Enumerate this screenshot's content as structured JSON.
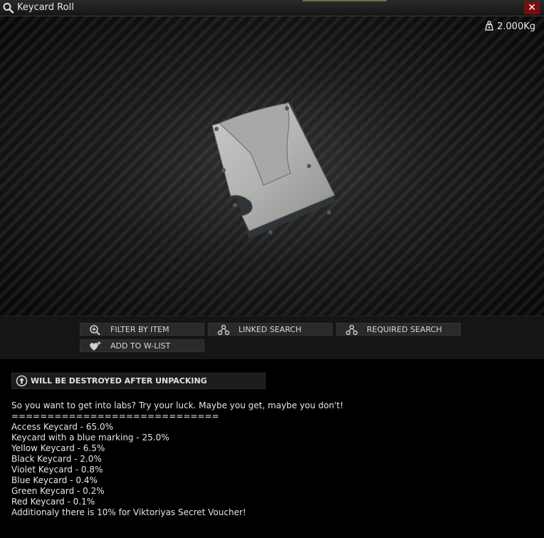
{
  "window": {
    "title": "Keycard Roll",
    "close_label": "✕"
  },
  "item": {
    "weight": "2.000Kg"
  },
  "actions": {
    "filter_by_item": "FILTER BY ITEM",
    "linked_search": "LINKED SEARCH",
    "required_search": "REQUIRED SEARCH",
    "add_to_wlist": "ADD TO W-LIST"
  },
  "description": {
    "destroy_notice": "WILL BE DESTROYED AFTER UNPACKING",
    "lines": [
      "So you want to get into labs? Try your luck. Maybe you get, maybe you don't!",
      "=============================",
      "Access Keycard - 65.0%",
      "Keycard with a blue marking - 25.0%",
      "Yellow Keycard - 6.5%",
      "Black Keycard - 2.0%",
      "Violet Keycard - 0.8%",
      "Blue Keycard - 0.4%",
      "Green Keycard - 0.2%",
      "Red Keycard - 0.1%",
      "Additionaly there is 10% for Viktoriyas Secret Voucher!"
    ]
  },
  "icons": {
    "title": "magnifier-icon",
    "weight": "weight-icon",
    "filter": "filter-search-icon",
    "linked": "linked-nodes-icon",
    "required": "required-nodes-icon",
    "wishlist": "heart-plus-icon",
    "destroy": "unpack-arrow-icon"
  },
  "colors": {
    "close_button": "#7a0f0f",
    "background": "#000000",
    "button_bg": "#2a2a2a"
  }
}
